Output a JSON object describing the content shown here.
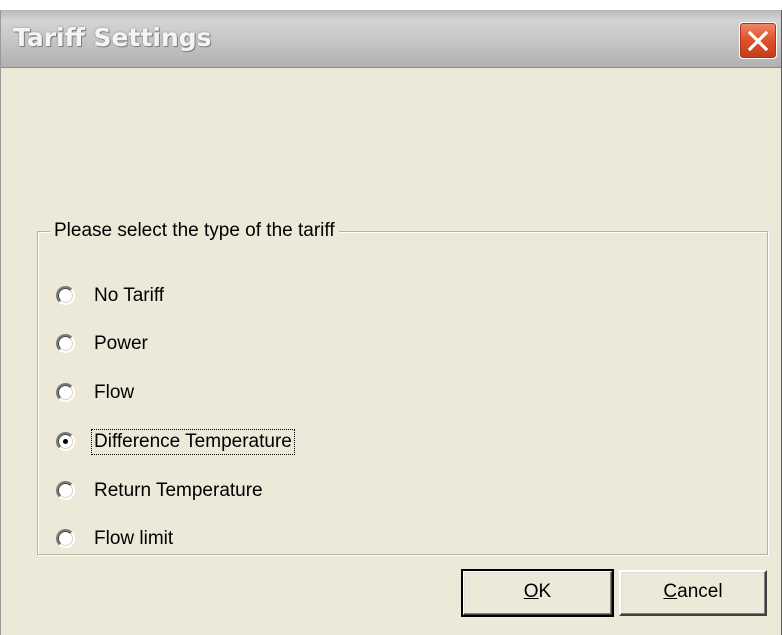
{
  "window": {
    "title": "Tariff Settings",
    "close_icon": "close-icon"
  },
  "tariff_group": {
    "legend": "Please select the type of the tariff",
    "options": [
      {
        "label": "No Tariff",
        "selected": false
      },
      {
        "label": "Power",
        "selected": false
      },
      {
        "label": "Flow",
        "selected": false
      },
      {
        "label": "Difference Temperature",
        "selected": true
      },
      {
        "label": "Return Temperature",
        "selected": false
      },
      {
        "label": "Flow limit",
        "selected": false
      }
    ]
  },
  "buttons": {
    "ok": {
      "mnemonic": "O",
      "rest": "K"
    },
    "cancel": {
      "mnemonic": "C",
      "rest": "ancel"
    }
  },
  "colors": {
    "dialog_bg": "#ece9d8",
    "close_button": "#e0542e"
  }
}
